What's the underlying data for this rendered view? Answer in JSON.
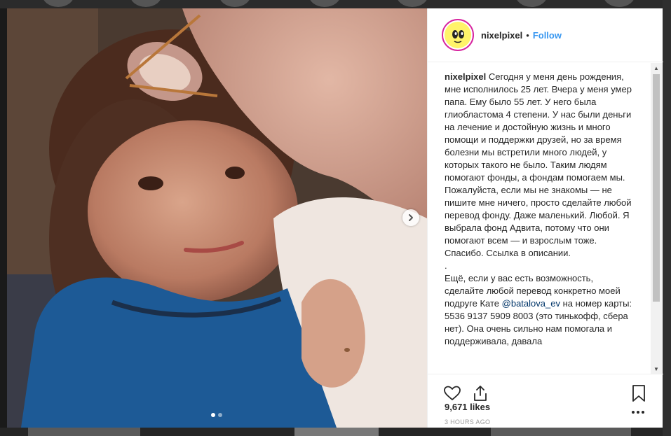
{
  "post": {
    "username": "nixelpixel",
    "separator": "•",
    "follow_label": "Follow",
    "caption_paragraph_1": "Сегодня у меня день рождения, мне исполнилось 25 лет. Вчера у меня умер папа. Ему было 55 лет. У него была глиобластома 4 степени. У нас были деньги на лечение и достойную жизнь и много помощи и поддержки друзей, но за время болезни мы встретили много людей, у которых такого не было. Таким людям помогают фонды, а фондам помогаем мы. Пожалуйста, если мы не знакомы — не пишите мне ничего, просто сделайте любой перевод фонду. Даже маленький. Любой. Я выбрала фонд Адвита, потому что они помогают всем — и взрослым тоже. Спасибо. Ссылка в описании.",
    "caption_dot": ".",
    "caption_paragraph_2_before": "Ещё, если у вас есть возможность, сделайте любой перевод конкретно моей подруге Кате",
    "mention": "@batalova_ev",
    "caption_paragraph_2_after": "на номер карты:",
    "card_line": "5536 9137 5909 8003 (это тинькофф, сбера нет). Она очень сильно нам помогала и поддерживала, давала",
    "likes": "9,671 likes",
    "time": "3 HOURS AGO",
    "carousel": {
      "count": 2,
      "active": 1
    }
  },
  "icons": {
    "like": "heart-icon",
    "share": "share-icon",
    "save": "bookmark-icon",
    "next": "chevron-right-icon",
    "more": "more-options-icon"
  },
  "colors": {
    "link": "#3897f0",
    "mention": "#003569",
    "text": "#262626",
    "muted": "#999999",
    "avatar_ring": "#d6249f",
    "avatar_fill": "#fff46a"
  }
}
